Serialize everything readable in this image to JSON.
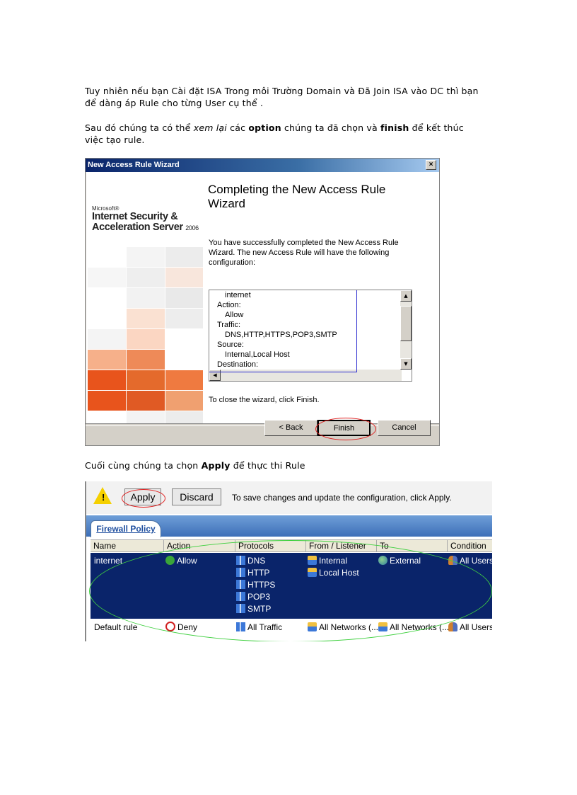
{
  "paragraphs": {
    "p1": "Tuy nhiên nếu bạn Cài đặt ISA Trong môi Trường Domain và Đã Join ISA vào DC thì bạn để dàng áp Rule cho từng User cụ thể .",
    "p2_a": "Sau đó chúng ta có thể ",
    "p2_b": "xem lại",
    "p2_c": " các ",
    "p2_d": "option",
    "p2_e": " chúng ta đã chọn và ",
    "p2_f": "finish",
    "p2_g": " để kết thúc việc tạo rule.",
    "p3_a": "Cuối cùng chúng ta chọn ",
    "p3_b": "Apply",
    "p3_c": " để thực thi Rule"
  },
  "wizard": {
    "title": "New Access Rule Wizard",
    "close_glyph": "×",
    "brand_ms": "Microsoft®",
    "brand_line1": "Internet Security &",
    "brand_line2": "Acceleration Server",
    "brand_year": "2006",
    "heading": "Completing the New Access Rule Wizard",
    "description": "You have successfully completed the New Access Rule Wizard. The new Access Rule will have the following configuration:",
    "summary_lines": [
      "internet",
      "Action:",
      "Allow",
      "Traffic:",
      "DNS,HTTP,HTTPS,POP3,SMTP",
      "Source:",
      "Internal,Local Host",
      "Destination:"
    ],
    "close_hint": "To close the wizard, click Finish.",
    "back_label": "< Back",
    "finish_label": "Finish",
    "cancel_label": "Cancel",
    "accent": "#e8541c"
  },
  "panel": {
    "apply_label": "Apply",
    "discard_label": "Discard",
    "apply_message": "To save changes and update the configuration, click Apply.",
    "tab_label": "Firewall Policy",
    "columns": [
      "Name",
      "Action",
      "Protocols",
      "From / Listener",
      "To",
      "Condition"
    ],
    "rows": [
      {
        "name": "internet",
        "action": "Allow",
        "protocols": [
          "DNS",
          "HTTP",
          "HTTPS",
          "POP3",
          "SMTP"
        ],
        "from": [
          "Internal",
          "Local Host"
        ],
        "to": "External",
        "condition": "All Users"
      },
      {
        "name": "Default rule",
        "action": "Deny",
        "protocols": [
          "All Traffic"
        ],
        "from": [
          "All Networks (..."
        ],
        "to": "All Networks (...",
        "condition": "All Users"
      }
    ],
    "selection_color": "#0a246a",
    "highlight_color": "#40d040"
  }
}
